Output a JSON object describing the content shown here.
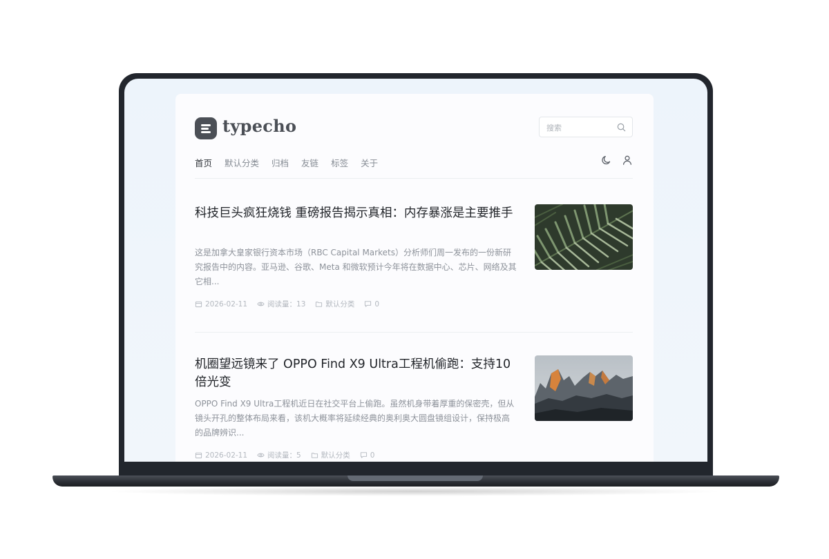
{
  "header": {
    "logo_text": "typecho",
    "search_placeholder": "搜索"
  },
  "nav": {
    "items": [
      "首页",
      "默认分类",
      "归档",
      "友链",
      "标签",
      "关于"
    ],
    "active_index": 0
  },
  "icons": {
    "logo": "typecho-logo-icon",
    "search": "search-icon",
    "theme": "moon-icon",
    "user": "user-icon",
    "date": "calendar-icon",
    "views": "eye-icon",
    "category": "folder-icon",
    "comments": "comment-icon"
  },
  "posts": [
    {
      "title": "科技巨头疯狂烧钱 重磅报告揭示真相：内存暴涨是主要推手",
      "excerpt": "这是加拿大皇家银行资本市场（RBC Capital Markets）分析师们周一发布的一份新研究报告中的内容。亚马逊、谷歌、Meta 和微软预计今年将在数据中心、芯片、网络及其它相...",
      "date": "2026-02-11",
      "views": "阅读量：13",
      "category": "默认分类",
      "comments": "0"
    },
    {
      "title": "机圈望远镜来了 OPPO Find X9 Ultra工程机偷跑：支持10倍光变",
      "excerpt": "OPPO Find X9 Ultra工程机近日在社交平台上偷跑。虽然机身带着厚重的保密壳，但从镜头开孔的整体布局来看，该机大概率将延续经典的奥利奥大圆盘镜组设计，保持极高的品牌辨识...",
      "date": "2026-02-11",
      "views": "阅读量：5",
      "category": "默认分类",
      "comments": "0"
    }
  ],
  "colors": {
    "laptop_frame": "#22262d",
    "screen_bg": "#eef4fa",
    "card_bg": "#fcfcfe",
    "title_text": "#22252a",
    "muted_text": "#8d929a"
  }
}
